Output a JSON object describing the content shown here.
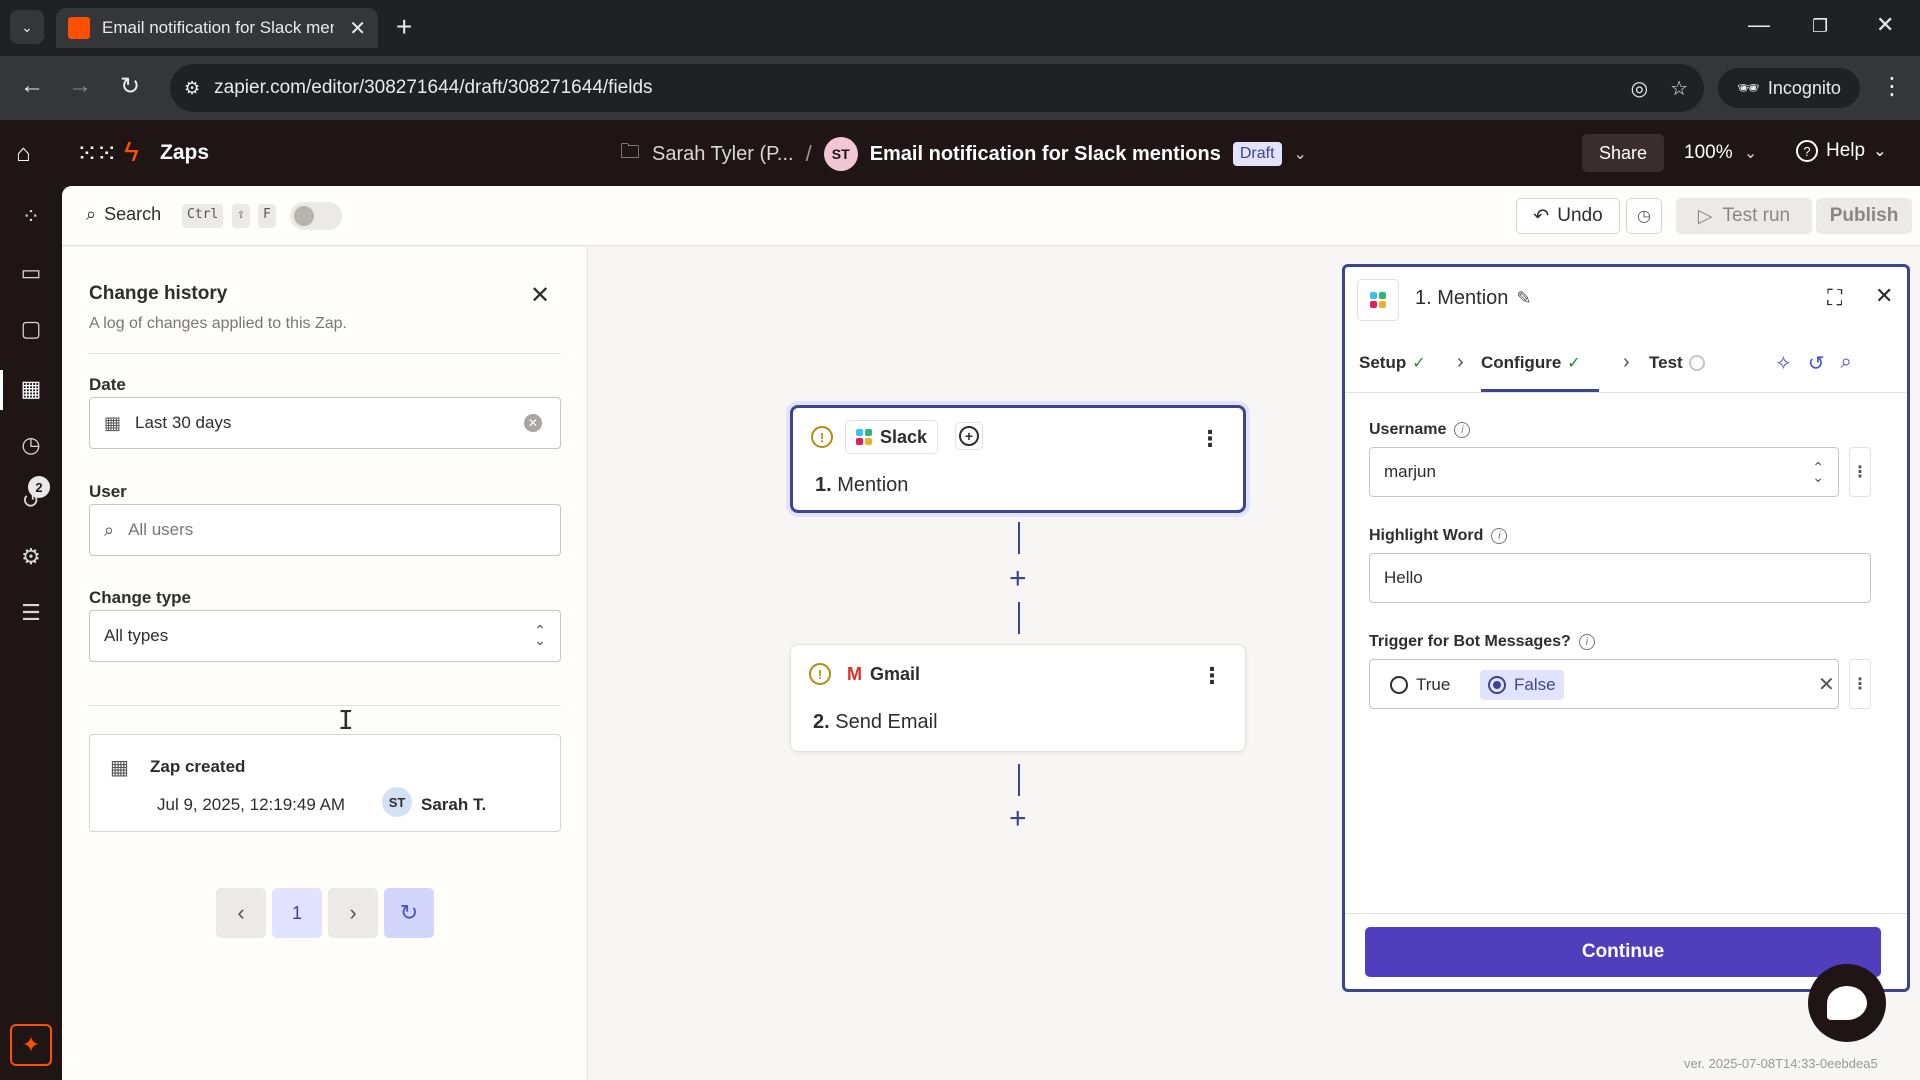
{
  "browser": {
    "tab_title": "Email notification for Slack men",
    "url": "zapier.com/editor/308271644/draft/308271644/fields",
    "profile": "Incognito"
  },
  "header": {
    "app_name": "Zaps",
    "folder": "Sarah Tyler (P...",
    "separator": "/",
    "owner_initials": "ST",
    "zap_title": "Email notification for Slack mentions",
    "status_badge": "Draft",
    "share_label": "Share",
    "zoom": "100%",
    "help_label": "Help"
  },
  "rail": {
    "notification_count": "2"
  },
  "toolbar": {
    "search_label": "Search",
    "shortcut_keys": [
      "Ctrl",
      "⇧",
      "F"
    ],
    "undo_label": "Undo",
    "test_run_label": "Test run",
    "publish_label": "Publish"
  },
  "history": {
    "title": "Change history",
    "subtitle": "A log of changes applied to this Zap.",
    "date_label": "Date",
    "date_value": "Last 30 days",
    "user_label": "User",
    "user_placeholder": "All users",
    "change_type_label": "Change type",
    "change_type_value": "All types",
    "entries": [
      {
        "title": "Zap created",
        "date": "Jul 9, 2025, 12:19:49 AM",
        "user_initials": "ST",
        "user_name": "Sarah T."
      }
    ],
    "current_page": "1"
  },
  "canvas": {
    "steps": [
      {
        "app": "Slack",
        "number": "1.",
        "name": "Mention"
      },
      {
        "app": "Gmail",
        "number": "2.",
        "name": "Send Email"
      }
    ]
  },
  "step_panel": {
    "title": "1. Mention",
    "tabs": [
      {
        "label": "Setup",
        "state": "complete"
      },
      {
        "label": "Configure",
        "state": "complete"
      },
      {
        "label": "Test",
        "state": "pending"
      }
    ],
    "fields": {
      "username_label": "Username",
      "username_value": "marjun",
      "highlight_label": "Highlight Word",
      "highlight_value": "Hello",
      "bot_label": "Trigger for Bot Messages?",
      "bot_options": [
        "True",
        "False"
      ],
      "bot_selected": "False"
    },
    "continue_label": "Continue"
  },
  "footer": {
    "version": "ver. 2025-07-08T14:33-0eebdea5"
  },
  "colors": {
    "brand_orange": "#ff4f00",
    "header_bg": "#201515",
    "accent": "#3d4592",
    "continue_bg": "#503ebd"
  }
}
